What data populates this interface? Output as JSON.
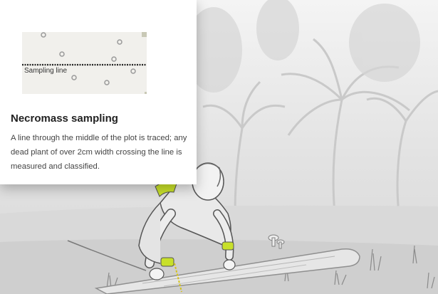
{
  "card": {
    "title": "Necromass sampling",
    "description": "A line through the middle of the plot is traced; any dead plant of over 2cm width crossing the line is measured and classified.",
    "diagram": {
      "line_label": "Sampling line"
    }
  },
  "colors": {
    "card_background": "#ffffff",
    "diagram_background": "#f1f0ec",
    "accent_green": "#c8e02a"
  },
  "illustration": {
    "subject": "researcher measuring a fallen log in a misty palm forest"
  }
}
